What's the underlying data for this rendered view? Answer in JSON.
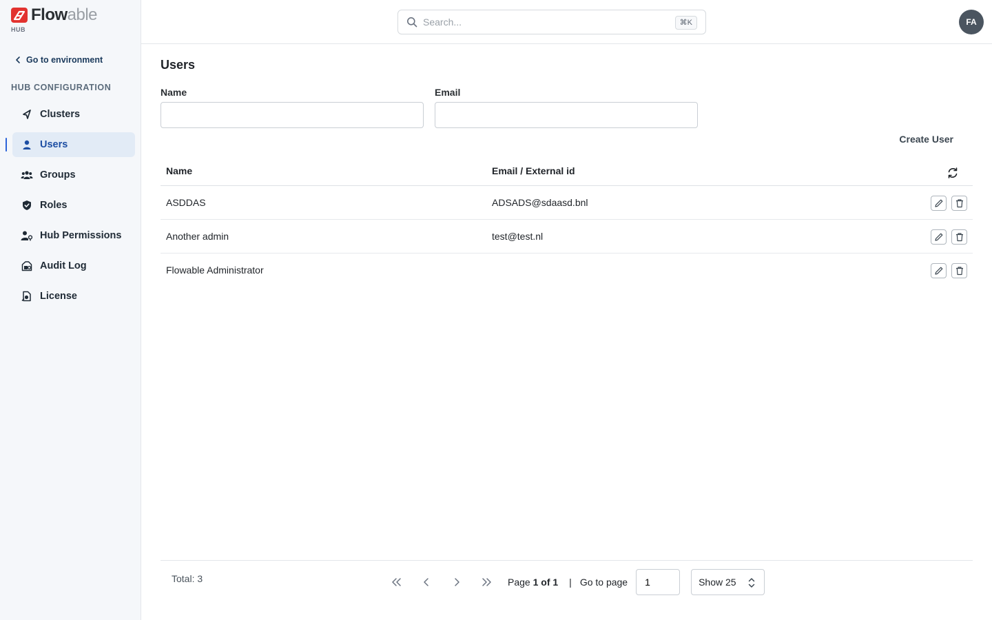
{
  "brand": {
    "name_bold": "Flow",
    "name_light": "able",
    "sub": "HUB",
    "accent": "#e2322f"
  },
  "sidebar": {
    "back_label": "Go to environment",
    "section_title": "HUB CONFIGURATION",
    "items": [
      {
        "label": "Clusters",
        "icon": "clusters-icon"
      },
      {
        "label": "Users",
        "icon": "user-icon",
        "active": true
      },
      {
        "label": "Groups",
        "icon": "groups-icon"
      },
      {
        "label": "Roles",
        "icon": "shield-icon"
      },
      {
        "label": "Hub Permissions",
        "icon": "user-key-icon"
      },
      {
        "label": "Audit Log",
        "icon": "audit-icon"
      },
      {
        "label": "License",
        "icon": "license-icon"
      }
    ]
  },
  "topbar": {
    "search_placeholder": "Search...",
    "shortcut": "⌘K",
    "avatar_initials": "FA"
  },
  "main": {
    "title": "Users",
    "filters": {
      "name_label": "Name",
      "name_value": "",
      "email_label": "Email",
      "email_value": ""
    },
    "create_label": "Create User",
    "table": {
      "columns": [
        "Name",
        "Email / External id"
      ],
      "rows": [
        {
          "name": "ASDDAS",
          "email": "ADSADS@sdaasd.bnl"
        },
        {
          "name": "Another admin",
          "email": "test@test.nl"
        },
        {
          "name": "Flowable Administrator",
          "email": ""
        }
      ]
    },
    "footer": {
      "total": "Total: 3",
      "page_prefix": "Page ",
      "page_status": "1 of 1",
      "separator": "|",
      "goto_label": "Go to page",
      "goto_value": "1",
      "show_label": "Show 25"
    }
  }
}
